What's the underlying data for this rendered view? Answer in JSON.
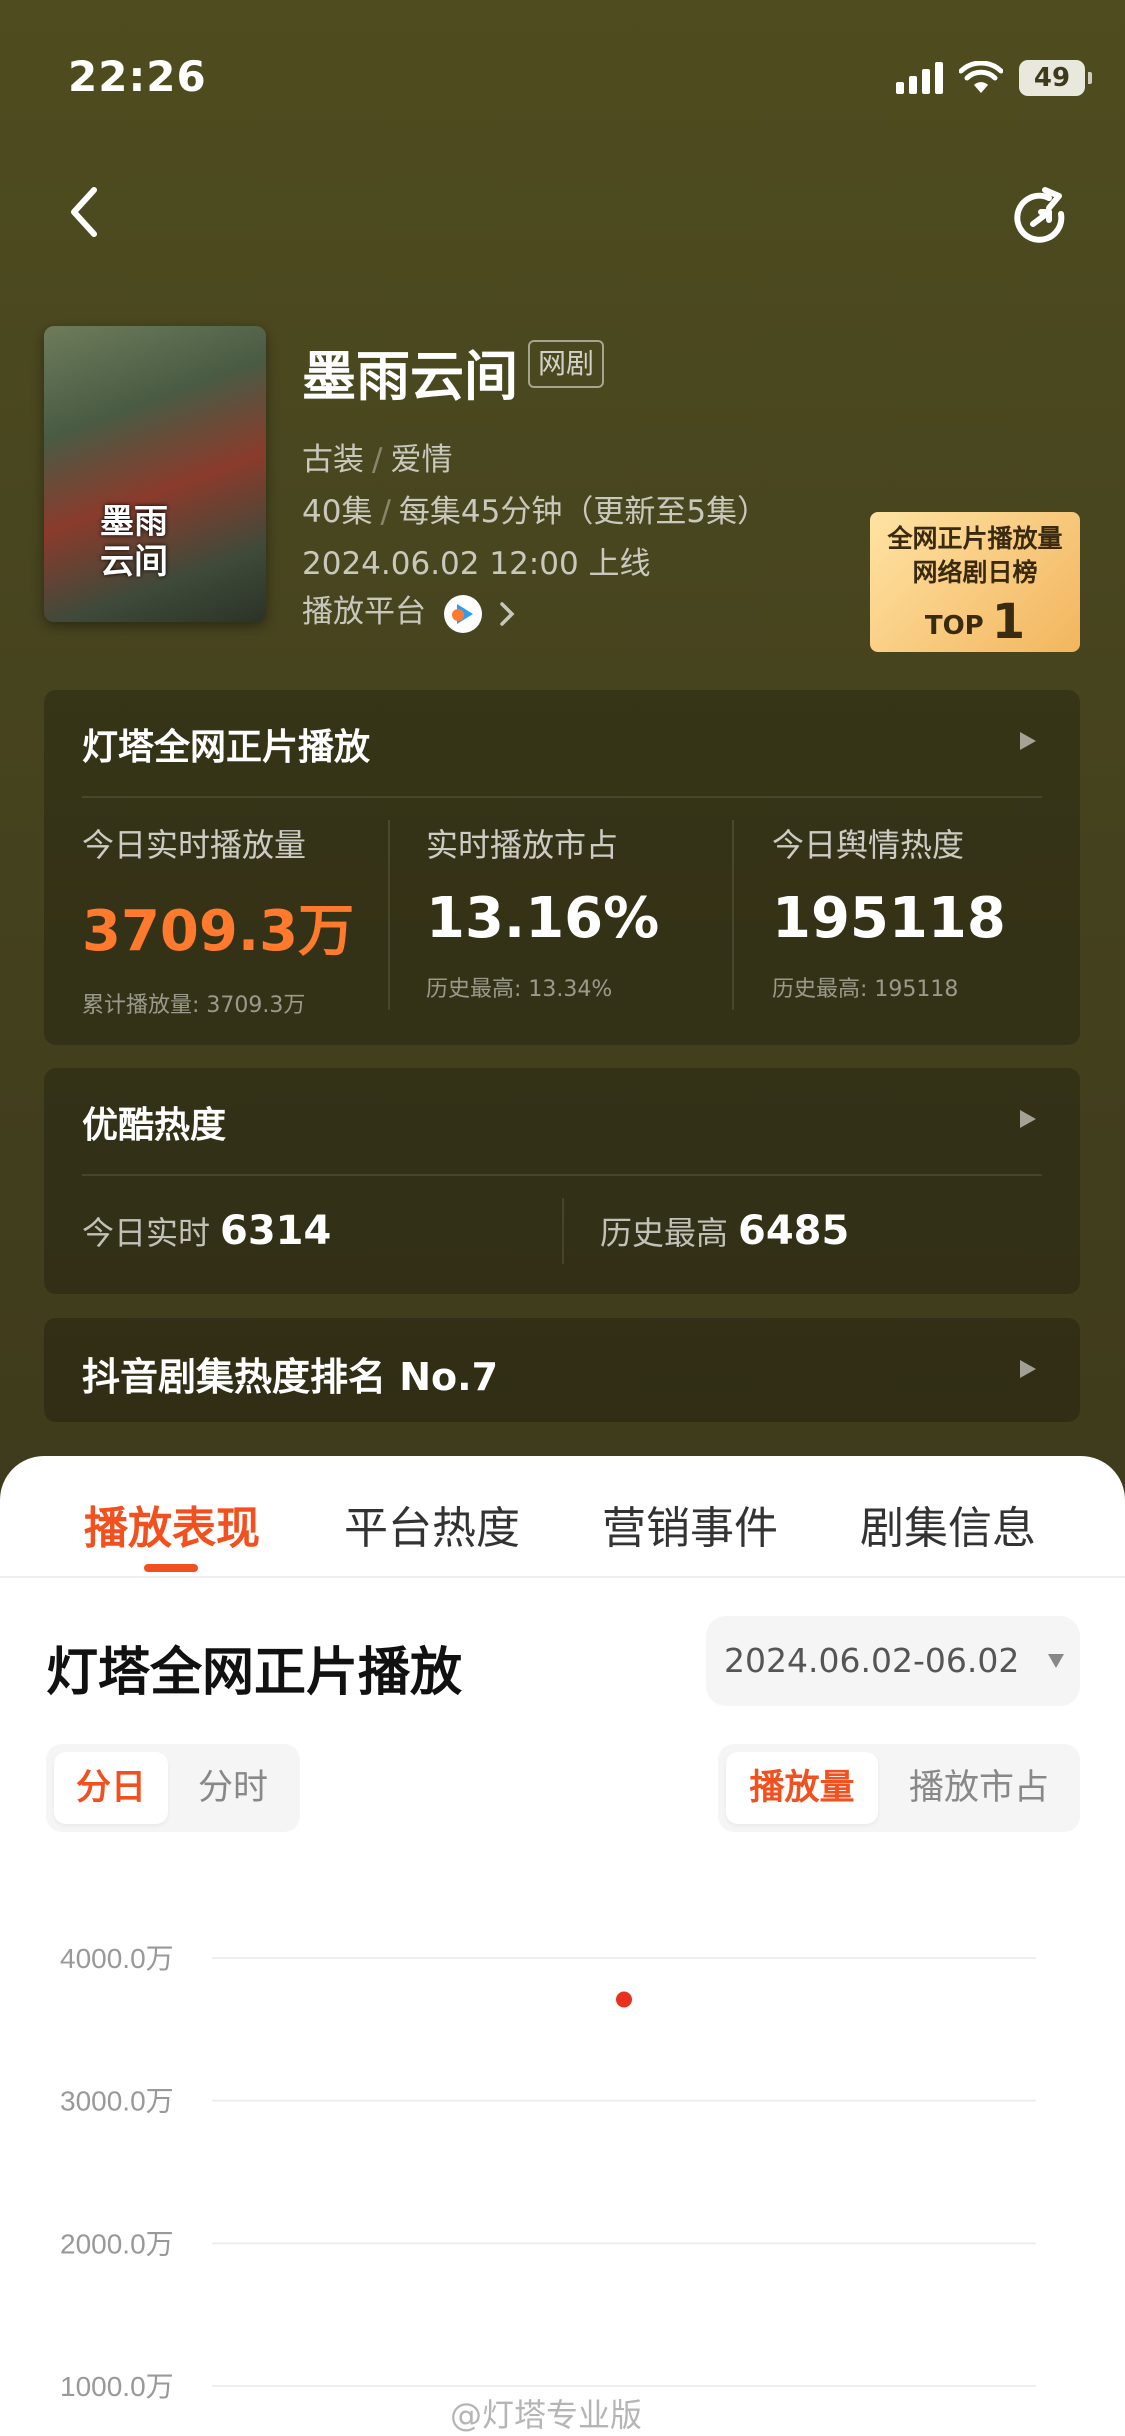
{
  "status_bar": {
    "time": "22:26",
    "battery": "49"
  },
  "drama": {
    "title": "墨雨云间",
    "type_tag": "网剧",
    "poster_title": "墨雨云间",
    "genres": [
      "古装",
      "爱情"
    ],
    "episodes": "40集",
    "episode_info": "每集45分钟（更新至5集）",
    "release": "2024.06.02 12:00 上线",
    "platform_label": "播放平台",
    "platform_icon": "youku-icon"
  },
  "rank_badge": {
    "line1": "全网正片播放量",
    "line2": "网络剧日榜",
    "top_label": "TOP",
    "top_num": "1"
  },
  "card_play": {
    "title": "灯塔全网正片播放",
    "stats": [
      {
        "label": "今日实时播放量",
        "value": "3709.3万",
        "sub": "累计播放量: 3709.3万"
      },
      {
        "label": "实时播放市占",
        "value": "13.16%",
        "sub": "历史最高: 13.34%"
      },
      {
        "label": "今日舆情热度",
        "value": "195118",
        "sub": "历史最高: 195118"
      }
    ]
  },
  "card_youku": {
    "title": "优酷热度",
    "today_label": "今日实时",
    "today_value": "6314",
    "max_label": "历史最高",
    "max_value": "6485"
  },
  "card_douyin": {
    "title": "抖音剧集热度排名 No.7"
  },
  "tabs": [
    "播放表现",
    "平台热度",
    "营销事件",
    "剧集信息"
  ],
  "section": {
    "title": "灯塔全网正片播放",
    "date_range": "2024.06.02-06.02",
    "granularity": [
      "分日",
      "分时"
    ],
    "metric": [
      "播放量",
      "播放市占"
    ]
  },
  "chart_data": {
    "type": "scatter",
    "y_ticks": [
      "4000.0万",
      "3000.0万",
      "2000.0万",
      "1000.0万"
    ],
    "tick_values": [
      4000,
      3000,
      2000,
      1000
    ],
    "points": [
      {
        "x": "2024.06.02",
        "y": 3709.3
      }
    ],
    "ylabel_unit": "万",
    "point_color": "#e8321d",
    "grid": true
  },
  "watermark": "@灯塔专业版",
  "colors": {
    "accent": "#f2511f",
    "stat_orange": "#ff7a2d"
  }
}
